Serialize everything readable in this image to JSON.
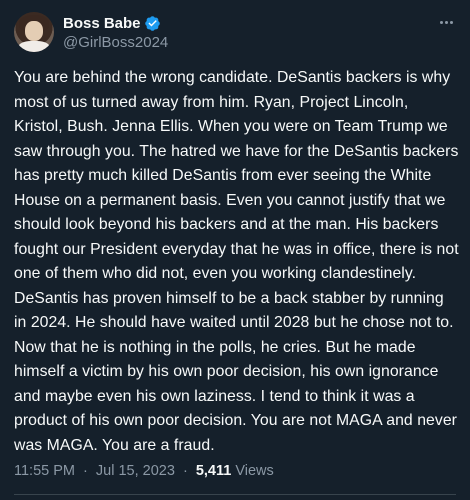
{
  "author": {
    "display_name": "Boss Babe",
    "handle": "@GirlBoss2024",
    "verified": true,
    "avatar_icon": "profile-photo"
  },
  "tweet": {
    "text": "You are behind the wrong candidate. DeSantis backers is why most of us turned away from him. Ryan, Project Lincoln, Kristol, Bush. Jenna Ellis. When you were on Team Trump we saw through you. The hatred we have for the DeSantis backers has pretty much killed DeSantis from ever seeing the White House on a permanent basis. Even you cannot justify that we should look beyond his backers and at the man. His backers fought our President everyday that he was in office, there is not one of them who did not, even you working clandestinely. DeSantis has proven himself to be a back stabber by running in 2024. He should have waited until 2028 but he chose not to. Now that he is nothing in the polls, he cries. But he made himself a victim by his own poor decision, his own ignorance and maybe even his own laziness. I tend to think it was a product of his own poor decision. You are not MAGA and never was MAGA. You are a fraud.",
    "time": "11:55 PM",
    "separator": "·",
    "date": "Jul 15, 2023",
    "views_count": "5,411",
    "views_label": "Views"
  },
  "colors": {
    "background": "#15202b",
    "text_primary": "#f7f9f9",
    "text_secondary": "#8b98a5",
    "verified_blue": "#1d9bf0",
    "divider": "#38444d"
  },
  "icons": {
    "verified": "verified-badge-icon",
    "more": "more-options-icon"
  }
}
